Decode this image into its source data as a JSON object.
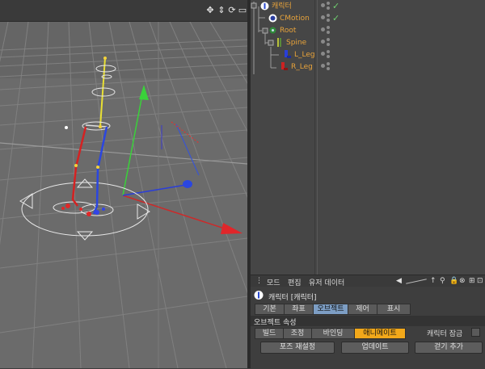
{
  "object_manager": {
    "rows": [
      {
        "label": "캐릭터",
        "checked": true
      },
      {
        "label": "CMotion",
        "checked": true
      },
      {
        "label": "Root",
        "checked": false
      },
      {
        "label": "Spine",
        "checked": false
      },
      {
        "label": "L_Leg",
        "checked": false
      },
      {
        "label": "R_Leg",
        "checked": false
      }
    ]
  },
  "attributes": {
    "menu": [
      "모드",
      "편집",
      "유저 데이터"
    ],
    "title": "캐릭터 [캐릭터]",
    "tabs": [
      "기본",
      "좌표",
      "오브젝트",
      "제어",
      "표시"
    ],
    "active_tab": "오브젝트",
    "section_title": "오브젝트 속성",
    "mode_tabs": [
      "빌드",
      "조정",
      "바인딩",
      "애니메이트"
    ],
    "active_mode": "애니메이트",
    "lock_label": "캐릭터 잠금",
    "buttons": [
      "포즈 재설정",
      "업데이트",
      "걷기 추가"
    ]
  },
  "colors": {
    "accent_tab": "#7d9ec4",
    "animate_tab": "#f2a81a",
    "object_label": "#e8a33a",
    "check": "#6fcf6f"
  }
}
